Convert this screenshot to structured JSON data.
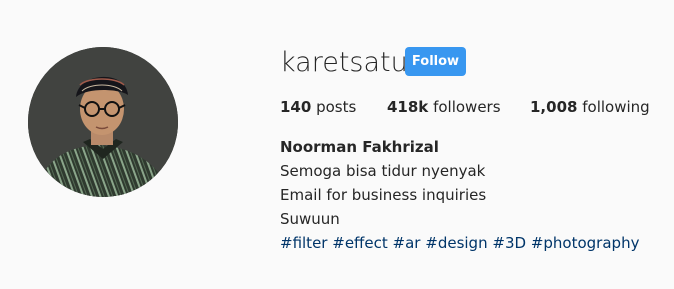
{
  "profile": {
    "username": "karetsatu",
    "follow_label": "Follow",
    "stats": {
      "posts_count": "140",
      "posts_label": "posts",
      "followers_count": "418k",
      "followers_label": "followers",
      "following_count": "1,008",
      "following_label": "following"
    },
    "full_name": "Noorman Fakhrizal",
    "bio_lines": [
      "Semoga bisa tidur nyenyak",
      "Email for business inquiries",
      "Suwuun"
    ],
    "hashtags": [
      "#filter",
      "#effect",
      "#ar",
      "#design",
      "#3D",
      "#photography"
    ]
  },
  "colors": {
    "background": "#fafafa",
    "text": "#262626",
    "follow_button": "#3897f0",
    "hashtag": "#003569"
  }
}
